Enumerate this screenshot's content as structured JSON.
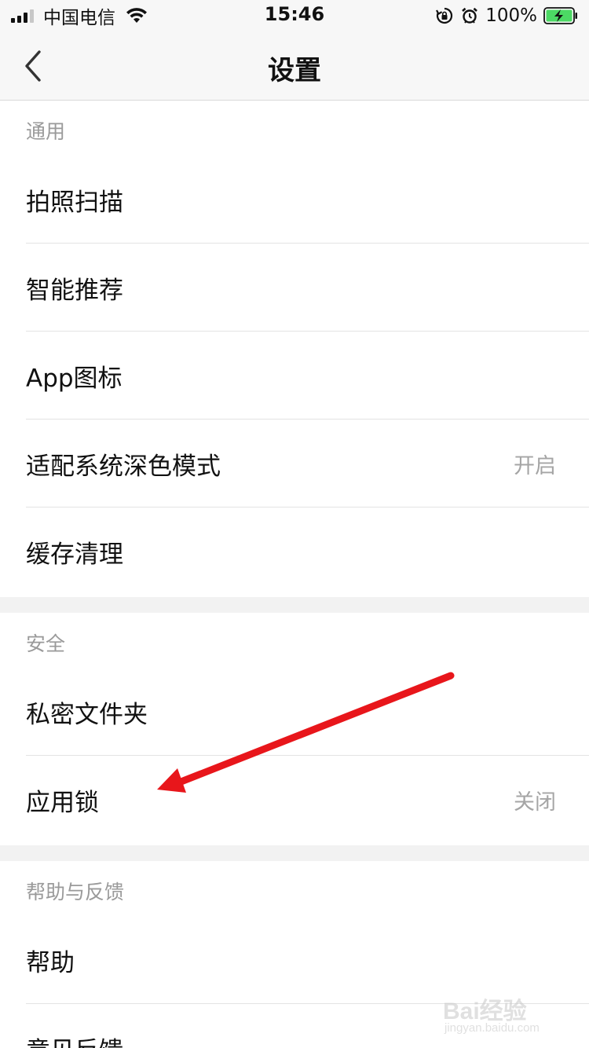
{
  "status_bar": {
    "carrier": "中国电信",
    "time": "15:46",
    "battery_percent": "100%",
    "icons": [
      "signal-icon",
      "wifi-icon",
      "rotation-lock-icon",
      "alarm-icon",
      "battery-charging-icon"
    ]
  },
  "nav": {
    "title": "设置",
    "back_icon": "chevron-left-icon"
  },
  "sections": {
    "general": {
      "header": "通用",
      "items": [
        {
          "label": "拍照扫描",
          "value": ""
        },
        {
          "label": "智能推荐",
          "value": ""
        },
        {
          "label": "App图标",
          "value": ""
        },
        {
          "label": "适配系统深色模式",
          "value": "开启"
        },
        {
          "label": "缓存清理",
          "value": ""
        }
      ]
    },
    "security": {
      "header": "安全",
      "items": [
        {
          "label": "私密文件夹",
          "value": ""
        },
        {
          "label": "应用锁",
          "value": "关闭"
        }
      ]
    },
    "help": {
      "header": "帮助与反馈",
      "items": [
        {
          "label": "帮助",
          "value": ""
        },
        {
          "label": "意见反馈",
          "value": ""
        }
      ]
    }
  },
  "annotation": {
    "arrow_color": "#e8161b"
  },
  "watermark": {
    "brand": "Bai经验",
    "url": "jingyan.baidu.com"
  }
}
